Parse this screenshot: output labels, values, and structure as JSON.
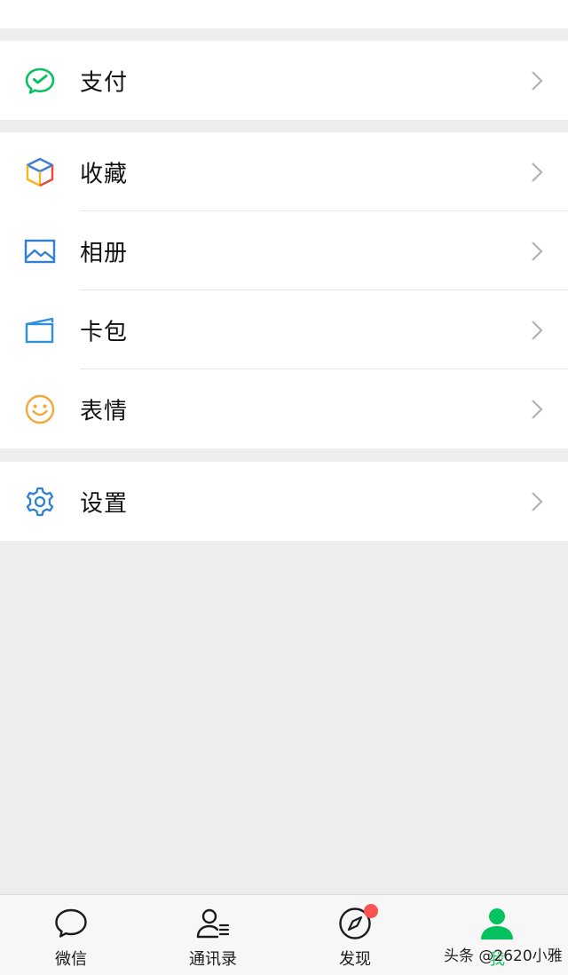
{
  "colors": {
    "background": "#ededed",
    "surface": "#ffffff",
    "accent_green": "#07c160",
    "badge_red": "#fa5151",
    "chevron": "#b2b2b2",
    "divider": "#e5e5e5"
  },
  "menu": {
    "pay": {
      "label": "支付",
      "icon": "wechat-pay-icon"
    },
    "favorites": {
      "label": "收藏",
      "icon": "cube-icon"
    },
    "album": {
      "label": "相册",
      "icon": "image-icon"
    },
    "cards": {
      "label": "卡包",
      "icon": "card-wallet-icon"
    },
    "stickers": {
      "label": "表情",
      "icon": "smiley-icon"
    },
    "settings": {
      "label": "设置",
      "icon": "gear-icon"
    }
  },
  "tabbar": {
    "tabs": [
      {
        "label": "微信",
        "icon": "chat-bubble-icon",
        "active": false
      },
      {
        "label": "通讯录",
        "icon": "contacts-icon",
        "active": false
      },
      {
        "label": "发现",
        "icon": "compass-icon",
        "active": false,
        "badge": true
      },
      {
        "label": "我",
        "icon": "person-icon",
        "active": true
      }
    ]
  },
  "watermark": {
    "text": "头条 @2620小雅"
  }
}
